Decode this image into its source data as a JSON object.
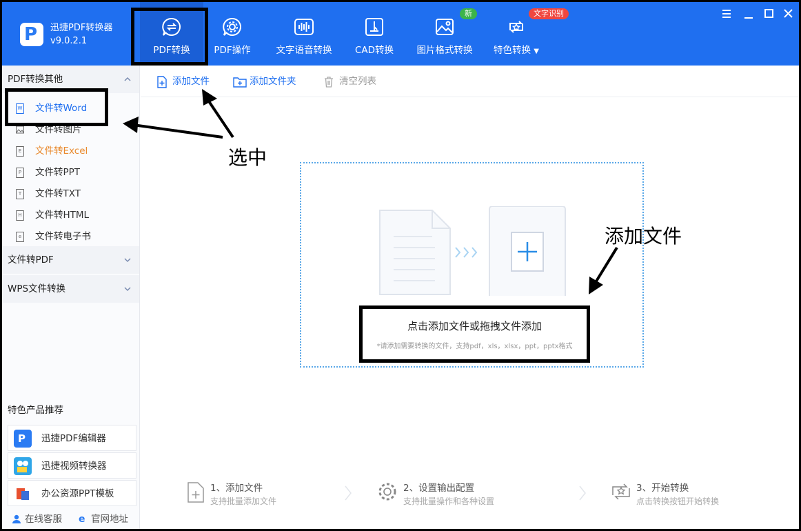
{
  "app": {
    "name": "迅捷PDF转换器",
    "version": "v9.0.2.1"
  },
  "tabs": [
    {
      "label": "PDF转换"
    },
    {
      "label": "PDF操作"
    },
    {
      "label": "文字语音转换"
    },
    {
      "label": "CAD转换"
    },
    {
      "label": "图片格式转换"
    },
    {
      "label": "特色转换"
    }
  ],
  "badges": {
    "new": "新",
    "ocr": "文字识别"
  },
  "sidebar": {
    "group_pdf_other": "PDF转换其他",
    "items": [
      {
        "label": "文件转Word",
        "icon": "W"
      },
      {
        "label": "文件转图片",
        "icon": ""
      },
      {
        "label": "文件转Excel",
        "icon": "E"
      },
      {
        "label": "文件转PPT",
        "icon": "P"
      },
      {
        "label": "文件转TXT",
        "icon": "T"
      },
      {
        "label": "文件转HTML",
        "icon": "H"
      },
      {
        "label": "文件转电子书",
        "icon": "e"
      }
    ],
    "group_to_pdf": "文件转PDF",
    "group_wps": "WPS文件转换",
    "promo_title": "特色产品推荐",
    "promos": [
      {
        "label": "迅捷PDF编辑器"
      },
      {
        "label": "迅捷视频转换器"
      },
      {
        "label": "办公资源PPT模板"
      }
    ],
    "online_service": "在线客服",
    "website": "官网地址"
  },
  "toolbar": {
    "add_file": "添加文件",
    "add_folder": "添加文件夹",
    "clear_list": "清空列表"
  },
  "dropzone": {
    "main": "点击添加文件或拖拽文件添加",
    "sub": "*请添加需要转换的文件，支持pdf，xls，xlsx，ppt，pptx格式"
  },
  "steps": [
    {
      "title": "1、添加文件",
      "desc": "支持批量添加文件"
    },
    {
      "title": "2、设置输出配置",
      "desc": "支持批量操作和各种设置"
    },
    {
      "title": "3、开始转换",
      "desc": "点击转换按钮开始转换"
    }
  ],
  "annotations": {
    "select": "选中",
    "add_file": "添加文件"
  },
  "colors": {
    "header": "#1f6ff0",
    "accent": "#1f6ff0",
    "excel": "#e9892c",
    "badge_new": "#3cb44a",
    "badge_ocr": "#f0473f"
  }
}
